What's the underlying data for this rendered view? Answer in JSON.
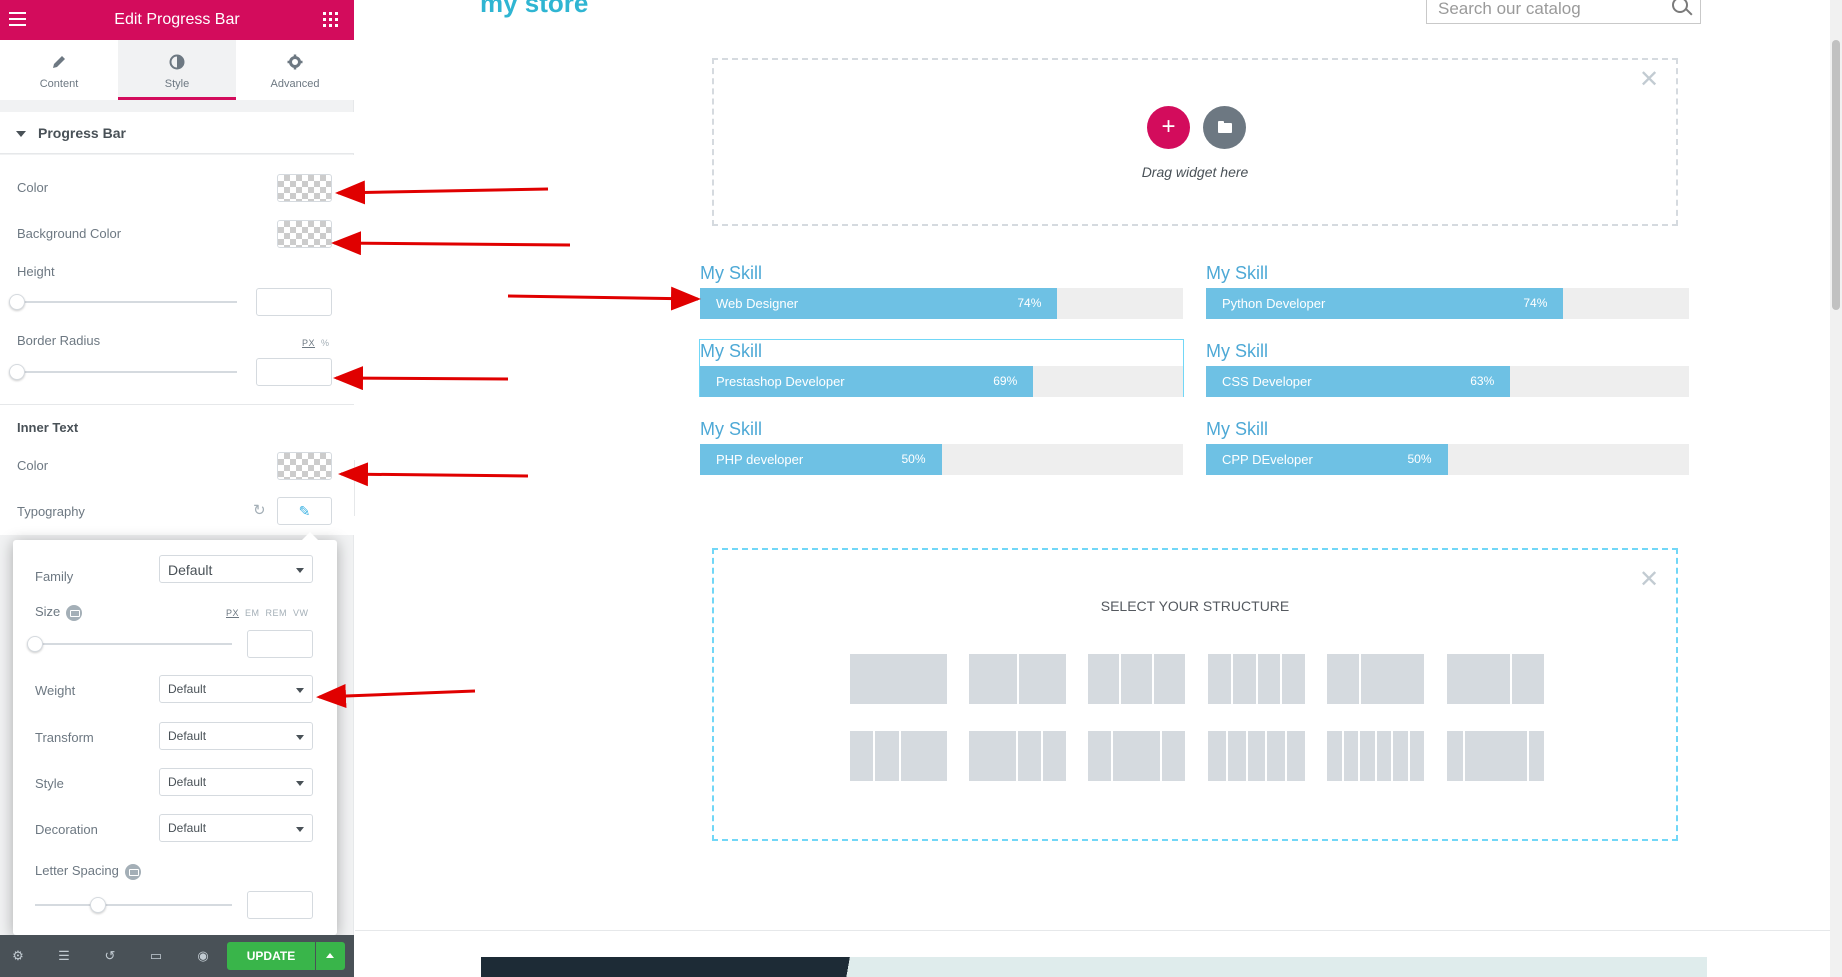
{
  "panel": {
    "title": "Edit Progress Bar",
    "tabs": [
      {
        "label": "Content",
        "icon": "pencil-icon"
      },
      {
        "label": "Style",
        "icon": "half-circle-icon"
      },
      {
        "label": "Advanced",
        "icon": "gear-icon"
      }
    ],
    "section_title": "Progress Bar",
    "color_label": "Color",
    "bg_color_label": "Background Color",
    "height_label": "Height",
    "border_radius_label": "Border Radius",
    "units_px": "PX",
    "units_pct": "%",
    "inner_text_heading": "Inner Text",
    "inner_color_label": "Color",
    "typography_label": "Typography"
  },
  "typography": {
    "family_label": "Family",
    "family_value": "Default",
    "size_label": "Size",
    "size_units": [
      "PX",
      "EM",
      "REM",
      "VW"
    ],
    "weight_label": "Weight",
    "weight_value": "Default",
    "transform_label": "Transform",
    "transform_value": "Default",
    "style_label": "Style",
    "style_value": "Default",
    "decoration_label": "Decoration",
    "decoration_value": "Default",
    "letter_spacing_label": "Letter Spacing"
  },
  "footer": {
    "update_label": "UPDATE",
    "icons": [
      "settings-icon",
      "layers-icon",
      "history-icon",
      "responsive-icon",
      "preview-eye-icon"
    ]
  },
  "preview": {
    "logo_partial": "my store",
    "search_placeholder": "Search our catalog",
    "drag_text": "Drag widget here",
    "skills": [
      {
        "title": "My Skill",
        "name": "Web Designer",
        "percent_label": "74%",
        "percent": 74
      },
      {
        "title": "My Skill",
        "name": "Python Developer",
        "percent_label": "74%",
        "percent": 74
      },
      {
        "title": "My Skill",
        "name": "Prestashop Developer",
        "percent_label": "69%",
        "percent": 69
      },
      {
        "title": "My Skill",
        "name": "CSS Developer",
        "percent_label": "63%",
        "percent": 63
      },
      {
        "title": "My Skill",
        "name": "PHP developer",
        "percent_label": "50%",
        "percent": 50
      },
      {
        "title": "My Skill",
        "name": "CPP DEveloper",
        "percent_label": "50%",
        "percent": 50
      }
    ],
    "structure_title": "SELECT YOUR STRUCTURE"
  },
  "colors": {
    "accent": "#d30c5c",
    "progress_fill": "#6ec1e4",
    "progress_track": "#eeeeee",
    "update_green": "#39b54a",
    "annotation_arrow": "#e00000"
  }
}
